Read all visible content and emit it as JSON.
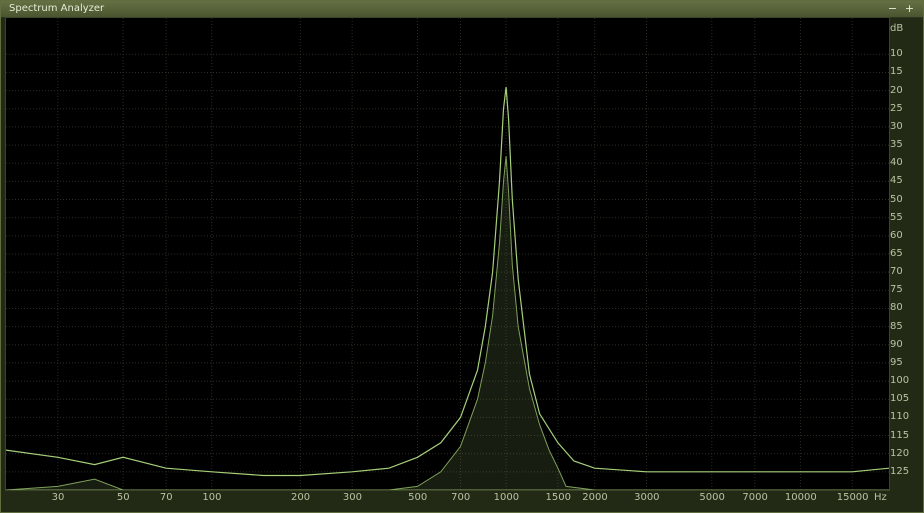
{
  "window": {
    "title": "Spectrum Analyzer",
    "minimize_glyph": "−",
    "maximize_glyph": "+"
  },
  "colors": {
    "background": "#000000",
    "grid": "#2a2d22",
    "trace_peak": "#a6d07a",
    "trace_fill": "#7fa05a"
  },
  "chart_data": {
    "type": "area",
    "title": "",
    "x_unit": "Hz",
    "y_unit": "dB",
    "x_scale": "log",
    "xlim": [
      20,
      20000
    ],
    "ylim": [
      -130,
      0
    ],
    "grid": true,
    "x_ticks": [
      {
        "value": 30,
        "label": "30"
      },
      {
        "value": 50,
        "label": "50"
      },
      {
        "value": 70,
        "label": "70"
      },
      {
        "value": 100,
        "label": "100"
      },
      {
        "value": 200,
        "label": "200"
      },
      {
        "value": 300,
        "label": "300"
      },
      {
        "value": 500,
        "label": "500"
      },
      {
        "value": 700,
        "label": "700"
      },
      {
        "value": 1000,
        "label": "1000"
      },
      {
        "value": 1500,
        "label": "1500"
      },
      {
        "value": 2000,
        "label": "2000"
      },
      {
        "value": 3000,
        "label": "3000"
      },
      {
        "value": 5000,
        "label": "5000"
      },
      {
        "value": 7000,
        "label": "7000"
      },
      {
        "value": 10000,
        "label": "10000"
      },
      {
        "value": 15000,
        "label": "15000"
      }
    ],
    "y_ticks": [
      -10,
      -15,
      -20,
      -25,
      -30,
      -35,
      -40,
      -45,
      -50,
      -55,
      -60,
      -65,
      -70,
      -75,
      -80,
      -85,
      -90,
      -95,
      -100,
      -105,
      -110,
      -115,
      -120,
      -125
    ],
    "series": [
      {
        "style": "line",
        "x": [
          20,
          30,
          40,
          50,
          70,
          100,
          150,
          200,
          300,
          400,
          500,
          600,
          700,
          800,
          850,
          900,
          950,
          980,
          1000,
          1020,
          1050,
          1100,
          1200,
          1300,
          1500,
          1700,
          2000,
          3000,
          5000,
          7000,
          10000,
          15000,
          20000
        ],
        "y": [
          -119,
          -121,
          -123,
          -121,
          -124,
          -125,
          -126,
          -126,
          -125,
          -124,
          -121,
          -117,
          -110,
          -97,
          -85,
          -70,
          -45,
          -25,
          -19,
          -28,
          -50,
          -72,
          -98,
          -109,
          -117,
          -122,
          -124,
          -125,
          -125,
          -125,
          -125,
          -125,
          -124
        ]
      },
      {
        "style": "filled",
        "x": [
          20,
          30,
          40,
          50,
          70,
          100,
          200,
          300,
          400,
          500,
          600,
          700,
          800,
          850,
          900,
          950,
          980,
          1000,
          1020,
          1050,
          1100,
          1200,
          1300,
          1400,
          1500,
          1600,
          2000,
          20000
        ],
        "y": [
          -130,
          -129,
          -127,
          -130,
          -130,
          -130,
          -130,
          -130,
          -130,
          -129,
          -125,
          -118,
          -105,
          -95,
          -82,
          -62,
          -45,
          -38,
          -48,
          -68,
          -85,
          -102,
          -112,
          -119,
          -124,
          -129,
          -130,
          -130
        ]
      }
    ]
  }
}
